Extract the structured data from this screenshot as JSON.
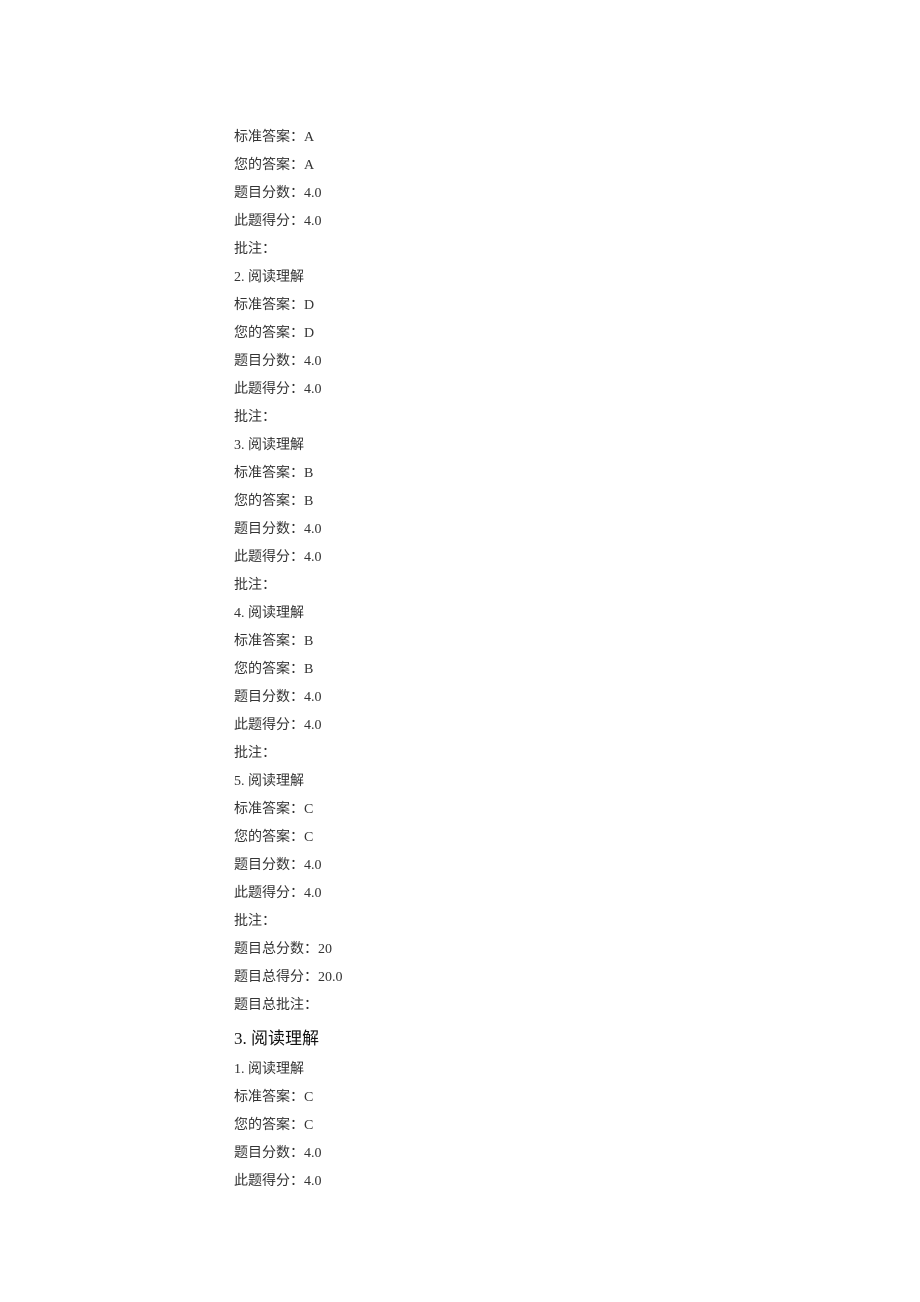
{
  "labels": {
    "standard_answer": "标准答案：",
    "your_answer": "您的答案：",
    "question_points": "题目分数：",
    "scored_points": "此题得分：",
    "note": "批注：",
    "total_points_label": "题目总分数：",
    "total_scored_label": "题目总得分：",
    "total_note_label": "题目总批注：",
    "reading_item_prefix": "阅读理解"
  },
  "questions": [
    {
      "number": "",
      "standard": "A",
      "yours": "A",
      "points": "4.0",
      "scored": "4.0",
      "note": ""
    },
    {
      "number": "2.",
      "standard": "D",
      "yours": "D",
      "points": "4.0",
      "scored": "4.0",
      "note": ""
    },
    {
      "number": "3.",
      "standard": "B",
      "yours": "B",
      "points": "4.0",
      "scored": "4.0",
      "note": ""
    },
    {
      "number": "4.",
      "standard": "B",
      "yours": "B",
      "points": "4.0",
      "scored": "4.0",
      "note": ""
    },
    {
      "number": "5.",
      "standard": "C",
      "yours": "C",
      "points": "4.0",
      "scored": "4.0",
      "note": ""
    }
  ],
  "section_total": {
    "points": "20",
    "scored": "20.0",
    "note": ""
  },
  "section_heading": "3. 阅读理解",
  "next_questions": [
    {
      "number": "1.",
      "standard": "C",
      "yours": "C",
      "points": "4.0",
      "scored": "4.0"
    }
  ]
}
